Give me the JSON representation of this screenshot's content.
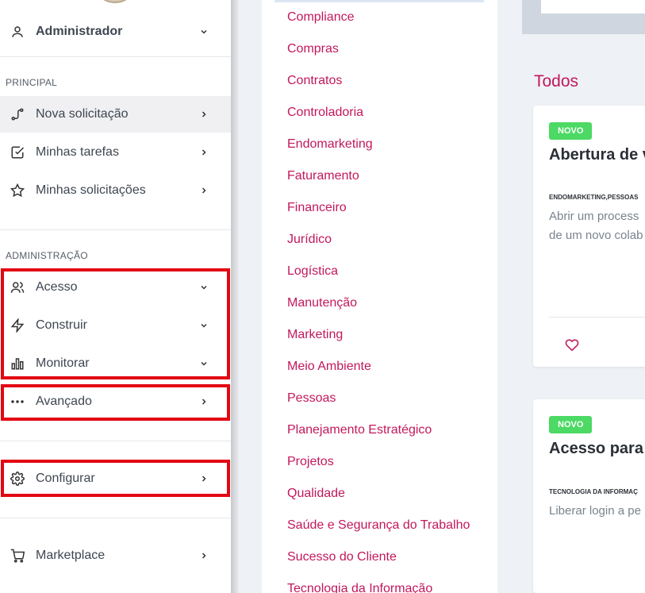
{
  "sidebar": {
    "user": {
      "name": "Administrador",
      "icon": "user-icon"
    },
    "sections": [
      {
        "title": "PRINCIPAL"
      },
      {
        "title": "ADMINISTRAÇÃO"
      }
    ],
    "items": [
      {
        "label": "Nova solicitação",
        "icon": "route-icon",
        "chevron": "right"
      },
      {
        "label": "Minhas tarefas",
        "icon": "checkbox-icon",
        "chevron": "right"
      },
      {
        "label": "Minhas solicitações",
        "icon": "star-icon",
        "chevron": "right"
      },
      {
        "label": "Acesso",
        "icon": "users-icon",
        "chevron": "down"
      },
      {
        "label": "Construir",
        "icon": "lightning-icon",
        "chevron": "down"
      },
      {
        "label": "Monitorar",
        "icon": "bar-chart-icon",
        "chevron": "down"
      },
      {
        "label": "Avançado",
        "icon": "dots-icon",
        "chevron": "right"
      },
      {
        "label": "Configurar",
        "icon": "gear-icon",
        "chevron": "right"
      },
      {
        "label": "Marketplace",
        "icon": "cart-icon",
        "chevron": "right"
      }
    ]
  },
  "categories": [
    "Compliance",
    "Compras",
    "Contratos",
    "Controladoria",
    "Endomarketing",
    "Faturamento",
    "Financeiro",
    "Jurídico",
    "Logística",
    "Manutenção",
    "Marketing",
    "Meio Ambiente",
    "Pessoas",
    "Planejamento Estratégico",
    "Projetos",
    "Qualidade",
    "Saúde e Segurança do Trabalho",
    "Sucesso do Cliente",
    "Tecnologia da Informação"
  ],
  "main": {
    "heading": "Todos",
    "cards": [
      {
        "badge": "NOVO",
        "title": "Abertura de v",
        "tags": "ENDOMARKETING,PESSOAS",
        "desc_line1": "Abrir um process",
        "desc_line2": "de um novo colab"
      },
      {
        "badge": "NOVO",
        "title": "Acesso para",
        "tags": "TECNOLOGIA DA INFORMAÇ",
        "desc_line1": "Liberar login a pe"
      }
    ]
  },
  "colors": {
    "accent": "#c2185b",
    "badge": "#4cd964",
    "highlight_box": "#e30613"
  }
}
